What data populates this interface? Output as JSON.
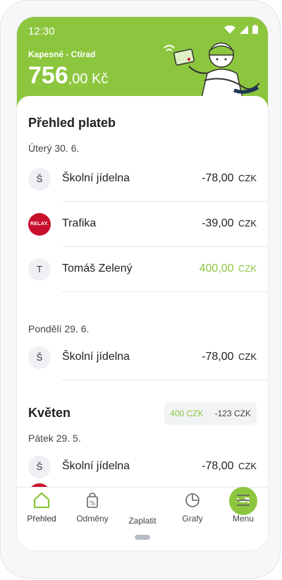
{
  "status_bar": {
    "time": "12:30"
  },
  "header": {
    "wallet_name": "Kapesné - Ctirad",
    "balance_main": "756",
    "balance_decimal": ",00 Kč"
  },
  "payments": {
    "title": "Přehled plateb",
    "groups": [
      {
        "date": "Úterý 30. 6.",
        "items": [
          {
            "avatar": "Š",
            "name": "Školní jídelna",
            "amount": "-78,00",
            "currency": "CZK"
          },
          {
            "avatar": "RELAY.",
            "name": "Trafika",
            "amount": "-39,00",
            "currency": "CZK"
          },
          {
            "avatar": "T",
            "name": "Tomáš Zelený",
            "amount": "400,00",
            "currency": "CZK"
          }
        ]
      },
      {
        "date": "Pondělí 29. 6.",
        "items": [
          {
            "avatar": "Š",
            "name": "Školní jídelna",
            "amount": "-78,00",
            "currency": "CZK"
          }
        ]
      }
    ]
  },
  "month": {
    "title": "Květen",
    "income": "400 CZK",
    "expense": "-123 CZK",
    "groups": [
      {
        "date": "Pátek 29. 5.",
        "items": [
          {
            "avatar": "Š",
            "name": "Školní jídelna",
            "amount": "-78,00",
            "currency": "CZK"
          }
        ]
      }
    ]
  },
  "nav": {
    "items": [
      {
        "label": "Přehled",
        "icon": "home-icon",
        "active": true
      },
      {
        "label": "Odměny",
        "icon": "bag-percent-icon"
      },
      {
        "label": "Zaplatit",
        "icon": "pay-icon"
      },
      {
        "label": "Grafy",
        "icon": "pie-chart-icon"
      },
      {
        "label": "Menu",
        "icon": "hamburger-icon"
      }
    ]
  },
  "colors": {
    "brand_green": "#8cc63e",
    "relay_red": "#c8102e"
  }
}
